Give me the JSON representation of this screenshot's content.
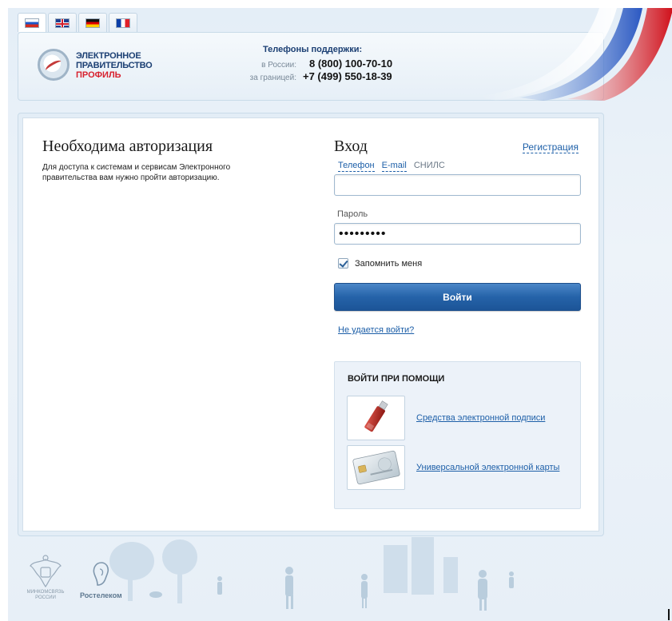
{
  "languages": [
    {
      "name": "russian",
      "active": true
    },
    {
      "name": "english",
      "active": false
    },
    {
      "name": "german",
      "active": false
    },
    {
      "name": "french",
      "active": false
    }
  ],
  "logo": {
    "line1": "ЭЛЕКТРОННОЕ",
    "line2": "ПРАВИТЕЛЬСТВО",
    "line3": "ПРОФИЛЬ"
  },
  "support": {
    "title": "Телефоны поддержки:",
    "russia_label": "в России:",
    "russia_phone": "8 (800) 100-70-10",
    "abroad_label": "за границей:",
    "abroad_phone": "+7 (499) 550-18-39"
  },
  "auth": {
    "title": "Необходима авторизация",
    "description": "Для доступа к системам и сервисам Электронного правительства вам нужно пройти авторизацию."
  },
  "login": {
    "title": "Вход",
    "register_label": "Регистрация",
    "tabs": [
      "Телефон",
      "E-mail",
      "СНИЛС"
    ],
    "login_value": "",
    "password_label": "Пароль",
    "password_value": "•••••••••",
    "remember_label": "Запомнить меня",
    "remember_checked": true,
    "submit_label": "Войти",
    "trouble_label": "Не удается войти?"
  },
  "alternative": {
    "title": "ВОЙТИ ПРИ ПОМОЩИ",
    "options": [
      {
        "label": "Средства электронной подписи",
        "icon": "usb-token-icon"
      },
      {
        "label": "Универсальной электронной карты",
        "icon": "smart-card-icon"
      }
    ]
  },
  "footer": {
    "ministry_label": "МИНКОМСВЯЗЬ РОССИИ",
    "operator_label": "Ростелеком"
  },
  "colors": {
    "accent": "#1d5fa8",
    "button": "#2563a9",
    "flag_red": "#d7212e",
    "flag_blue": "#1d57c8"
  }
}
